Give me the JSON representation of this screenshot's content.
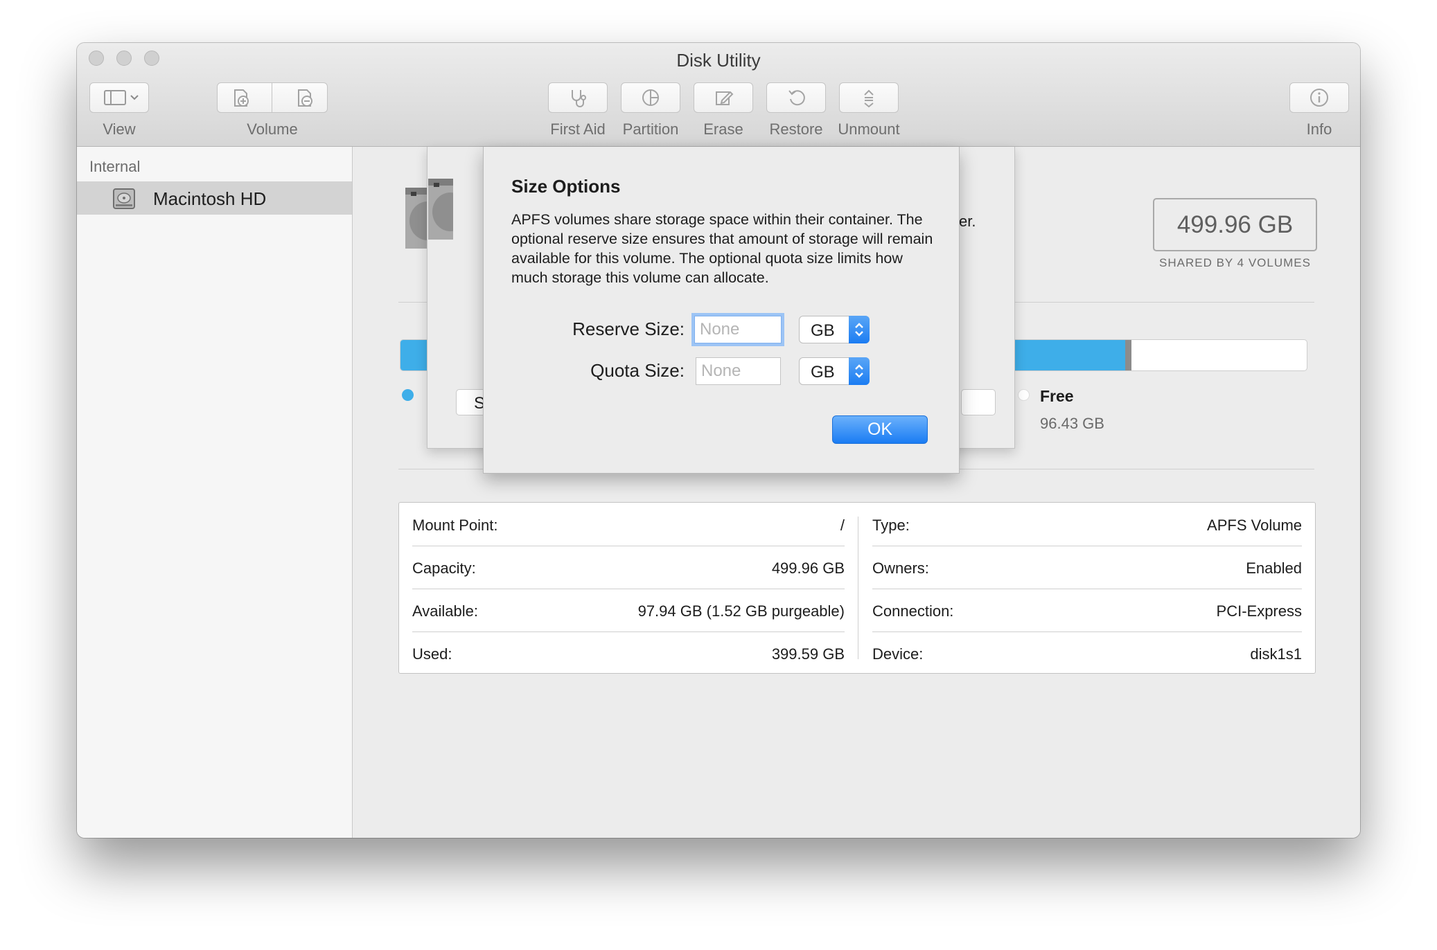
{
  "window": {
    "title": "Disk Utility",
    "toolbar": {
      "view_label": "View",
      "volume_label": "Volume",
      "first_aid_label": "First Aid",
      "partition_label": "Partition",
      "erase_label": "Erase",
      "restore_label": "Restore",
      "unmount_label": "Unmount",
      "info_label": "Info"
    }
  },
  "sidebar": {
    "section": "Internal",
    "items": [
      {
        "label": "Macintosh HD",
        "icon": "hard-drive-icon"
      }
    ]
  },
  "main": {
    "capacity_value": "499.96 GB",
    "capacity_caption": "SHARED BY 4 VOLUMES",
    "usage": {
      "used_fraction": 0.8,
      "free_label": "Free",
      "free_value": "96.43 GB",
      "used_color": "#3eaee9"
    },
    "info_left": [
      {
        "key": "Mount Point:",
        "value": "/"
      },
      {
        "key": "Capacity:",
        "value": "499.96 GB"
      },
      {
        "key": "Available:",
        "value": "97.94 GB (1.52 GB purgeable)"
      },
      {
        "key": "Used:",
        "value": "399.59 GB"
      }
    ],
    "info_right": [
      {
        "key": "Type:",
        "value": "APFS Volume"
      },
      {
        "key": "Owners:",
        "value": "Enabled"
      },
      {
        "key": "Connection:",
        "value": "PCI-Express"
      },
      {
        "key": "Device:",
        "value": "disk1s1"
      }
    ]
  },
  "background_sheet": {
    "text_fragment": "er.",
    "button_fragment": "S"
  },
  "dialog": {
    "title": "Size Options",
    "body": "APFS volumes share storage space within their container. The optional reserve size ensures that amount of storage will remain available for this volume. The optional quota size limits how much storage this volume can allocate.",
    "reserve_label": "Reserve Size:",
    "reserve_placeholder": "None",
    "reserve_unit": "GB",
    "quota_label": "Quota Size:",
    "quota_placeholder": "None",
    "quota_unit": "GB",
    "ok_label": "OK"
  }
}
